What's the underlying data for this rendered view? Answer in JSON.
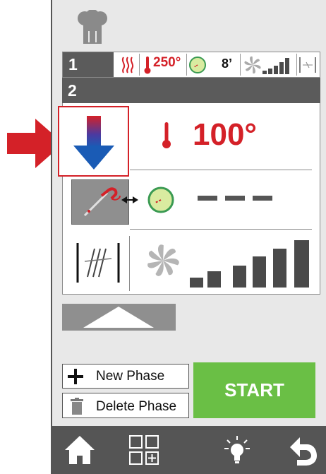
{
  "phases": [
    {
      "number": "1",
      "temperature": "250°",
      "time": "8’",
      "fan_level": 5,
      "active": false
    },
    {
      "number": "2",
      "temperature": "100°",
      "time": "---",
      "fan_level": 5,
      "active": true
    }
  ],
  "phase2": {
    "number": "2",
    "temperature": "100°",
    "direction": "down",
    "time_display": "---",
    "fan_bars": 5
  },
  "buttons": {
    "new_phase": "New Phase",
    "delete_phase": "Delete Phase",
    "start": "START"
  },
  "footer": {
    "icons": [
      "home-icon",
      "grid-add-icon",
      "light-icon",
      "back-icon"
    ]
  },
  "colors": {
    "accent_red": "#d42128",
    "start_green": "#6abf45",
    "dark_bar": "#5b5b5b",
    "arrow_blue": "#1a5bb5"
  }
}
